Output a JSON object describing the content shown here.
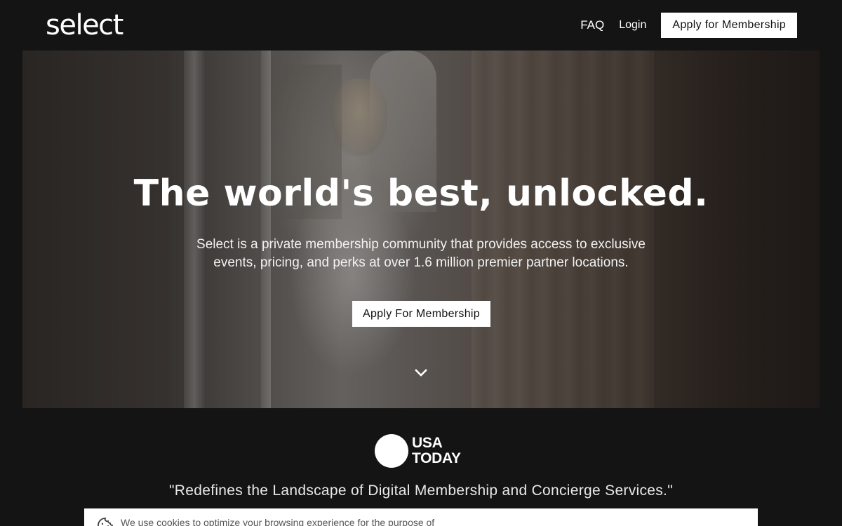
{
  "header": {
    "logo": "select",
    "nav": {
      "faq": "FAQ",
      "login": "Login",
      "apply": "Apply for Membership"
    }
  },
  "hero": {
    "title": "The world's best, unlocked.",
    "subtitle": "Select is a private membership community that provides access to exclusive events, pricing, and perks at over 1.6 million premier partner locations.",
    "cta": "Apply For Membership",
    "scroll_icon": "chevron-down-icon"
  },
  "press": {
    "logo_line1": "USA",
    "logo_line2": "TODAY",
    "quote": "\"Redefines the Landscape of Digital Membership and Concierge Services.\""
  },
  "cookie_banner": {
    "icon": "cookie-icon",
    "text": "We use cookies to optimize your browsing experience for the purpose of"
  },
  "colors": {
    "background": "#141414",
    "button_bg": "#ffffff",
    "button_text": "#111111"
  }
}
